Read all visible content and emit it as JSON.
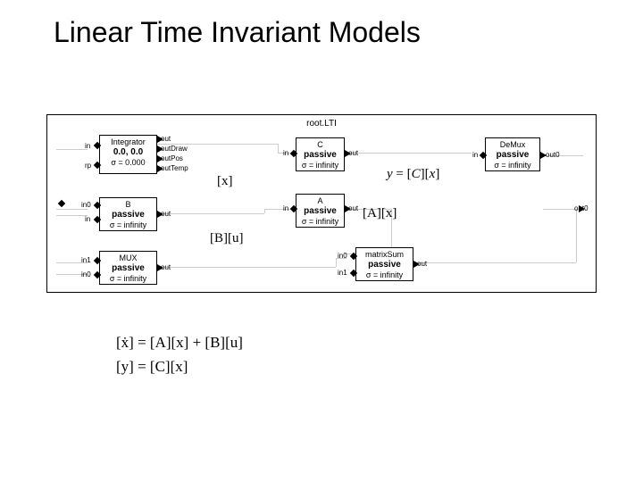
{
  "title": "Linear Time Invariant Models",
  "root_label": "root.LTI",
  "blocks": {
    "integrator": {
      "name": "Integrator",
      "big": "0.0, 0.0",
      "sigma": "σ = 0.000",
      "ports_l": [
        "in",
        "rp"
      ],
      "ports_r": [
        "out",
        "outDraw",
        "outPos",
        "outTemp"
      ]
    },
    "B": {
      "name": "B",
      "state": "passive",
      "sigma": "σ = infinity",
      "ports_l": [
        "in0",
        "in"
      ],
      "ports_r": [
        "out"
      ]
    },
    "MUX": {
      "name": "MUX",
      "state": "passive",
      "sigma": "σ = infinity",
      "ports_l": [
        "in1",
        "in0"
      ],
      "ports_r": [
        "out"
      ]
    },
    "C": {
      "name": "C",
      "state": "passive",
      "sigma": "σ = infinity",
      "ports_l": [
        "in"
      ],
      "ports_r": [
        "out"
      ]
    },
    "A": {
      "name": "A",
      "state": "passive",
      "sigma": "σ = infinity",
      "ports_l": [
        "in"
      ],
      "ports_r": [
        "out"
      ]
    },
    "matrixSum": {
      "name": "matrixSum",
      "state": "passive",
      "sigma": "σ = infinity",
      "ports_l": [
        "in0",
        "in1"
      ],
      "ports_r": [
        "out"
      ]
    },
    "DeMux": {
      "name": "DeMux",
      "state": "passive",
      "sigma": "σ = infinity",
      "ports_l": [
        "in"
      ],
      "ports_r": [
        "out0",
        "out0"
      ]
    }
  },
  "math": {
    "x_label": "[x]",
    "Bu_label": "[B][u]",
    "Ax_label": "[A][x]",
    "y_label": "y = [C][x]"
  },
  "equations": {
    "eq1": "[ẋ] = [A][x] + [B][u]",
    "eq2": "[y] = [C][x]"
  }
}
